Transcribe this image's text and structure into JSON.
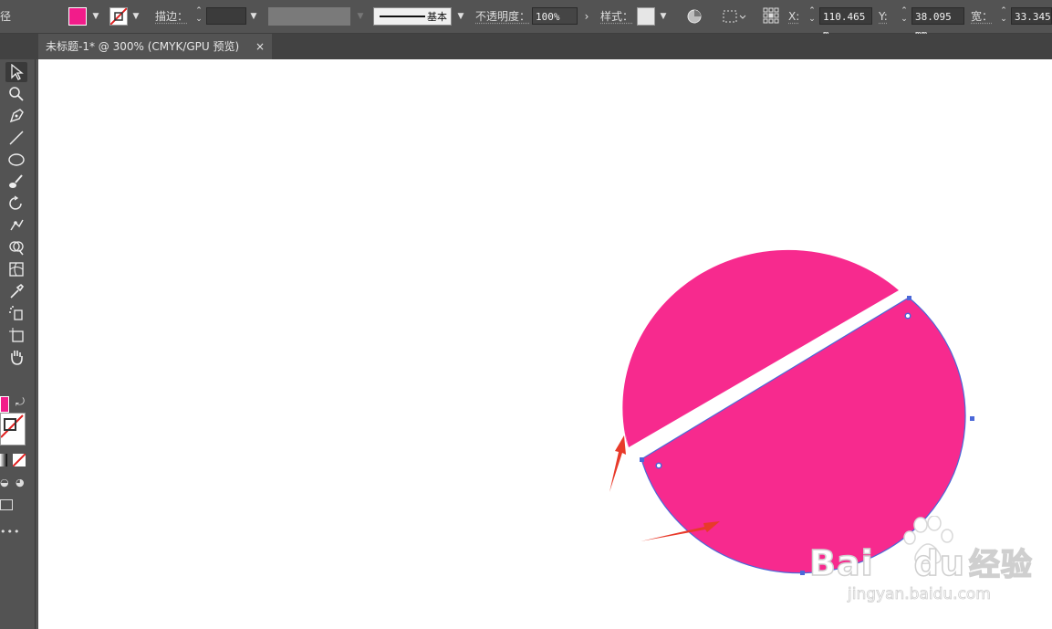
{
  "control_bar": {
    "left_cut_glyph": "径",
    "stroke_label": "描边：",
    "stroke_profile_label": "基本",
    "opacity_label": "不透明度：",
    "opacity_value": "100%",
    "style_label": "样式：",
    "x_label": "X:",
    "x_value": "110.465 m",
    "y_label": "Y:",
    "y_value": "38.095 mm",
    "width_label": "宽：",
    "width_value": "33.345",
    "fill_color": "#f21c8a"
  },
  "tab": {
    "title": "未标题-1* @ 300% (CMYK/GPU 预览)",
    "close_glyph": "×"
  },
  "artwork": {
    "fill_color": "#f72a8e",
    "path_color": "#4b68d8"
  },
  "annotations": {
    "arrow_color": "#e83a2a"
  },
  "watermark": {
    "brand_bai": "Bai",
    "brand_du": "du",
    "brand_jingyan": "经验",
    "url": "jingyan.baidu.com"
  }
}
